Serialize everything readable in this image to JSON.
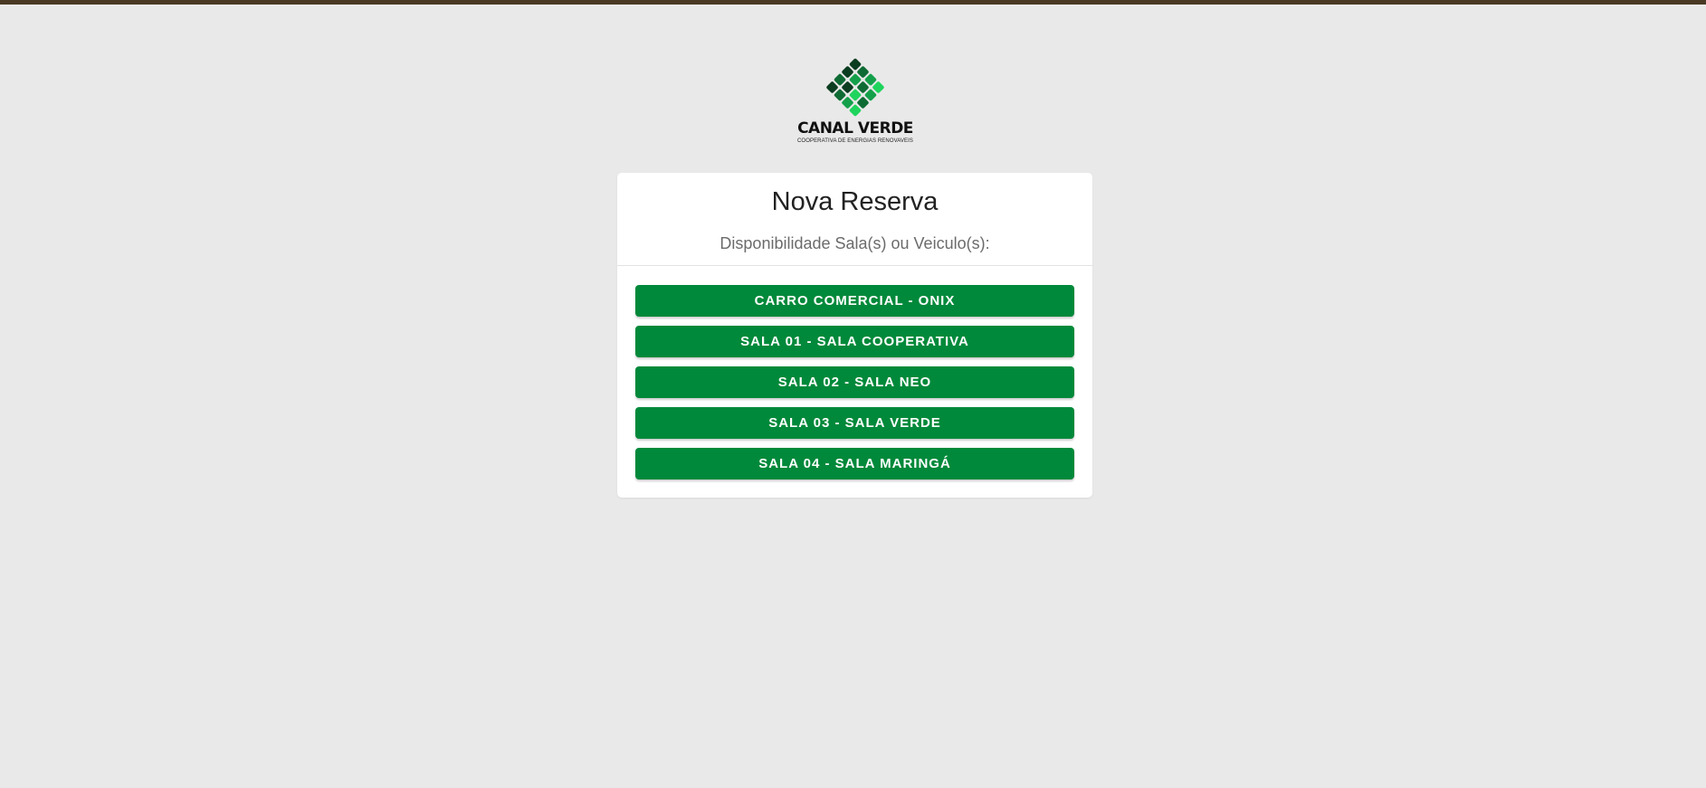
{
  "logo": {
    "title": "CANAL VERDE",
    "subtitle": "COOPERATIVA DE ENERGIAS RENOVAVEIS",
    "colors": [
      "#0b3d20",
      "#0f6b34",
      "#14a04a",
      "#1fd45c"
    ]
  },
  "card": {
    "title": "Nova Reserva",
    "subtitle": "Disponibilidade Sala(s) ou Veiculo(s):"
  },
  "resources": [
    {
      "label": "CARRO COMERCIAL - ONIX"
    },
    {
      "label": "SALA 01 - SALA COOPERATIVA"
    },
    {
      "label": "SALA 02 - SALA NEO"
    },
    {
      "label": "SALA 03 - SALA VERDE"
    },
    {
      "label": "SALA 04 - SALA MARINGÁ"
    }
  ],
  "colors": {
    "background": "#e9e9e9",
    "topbar": "#4a3a24",
    "button": "#00893a",
    "card": "#ffffff"
  }
}
